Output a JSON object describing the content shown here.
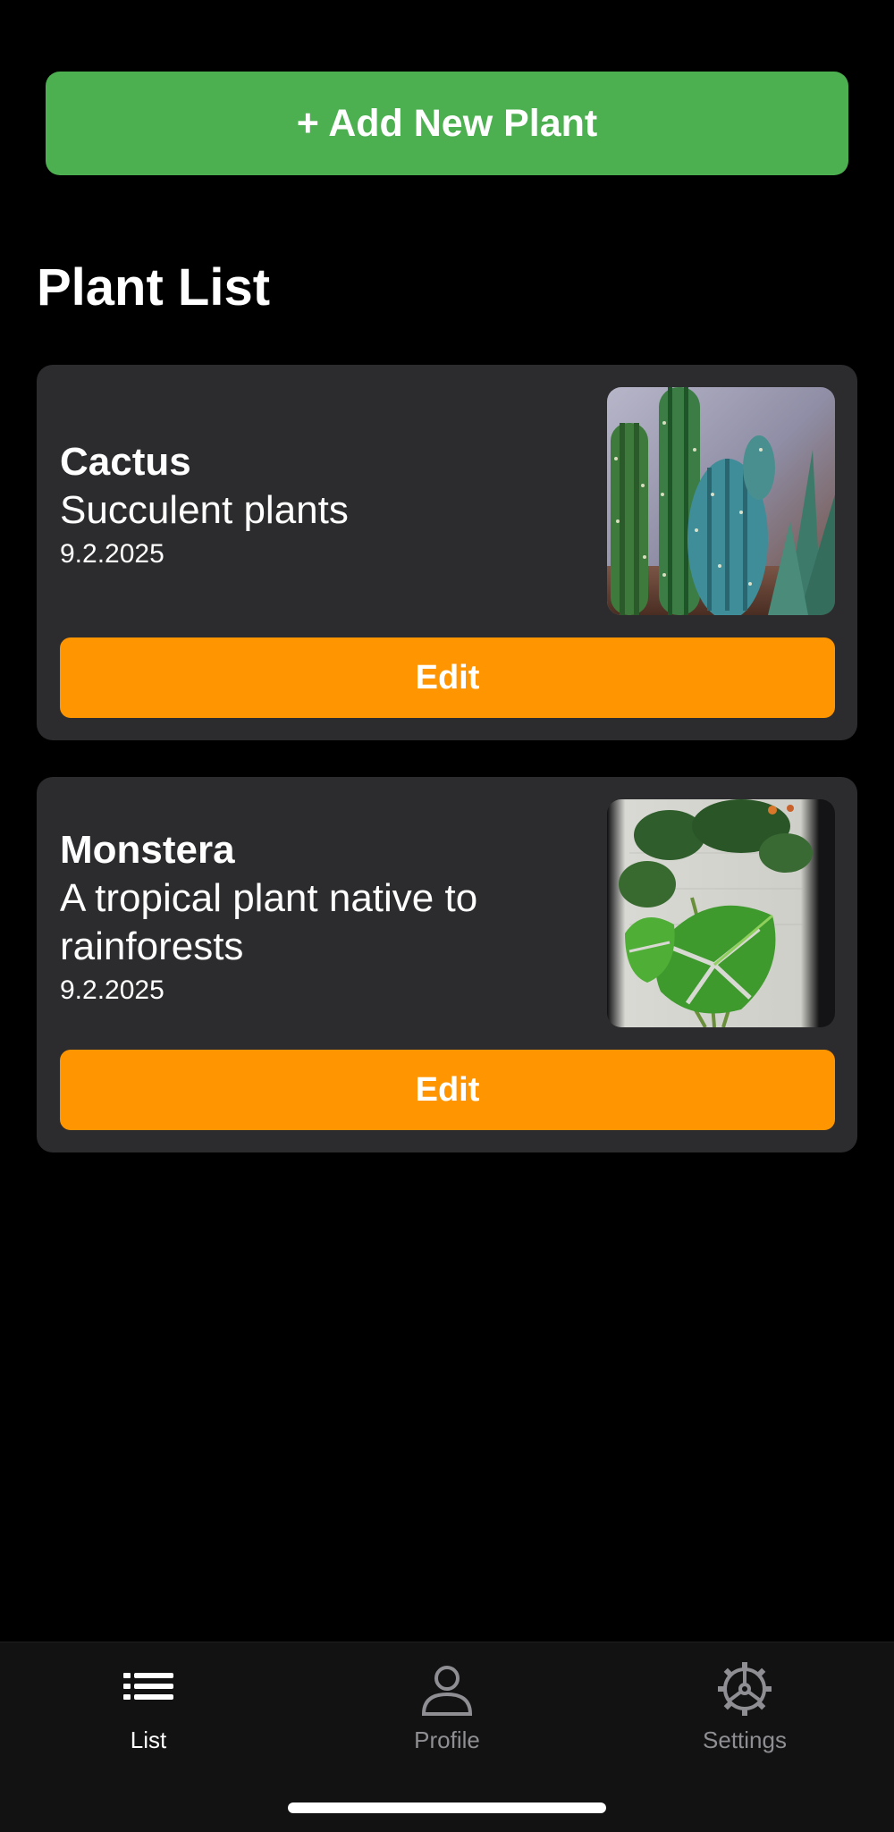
{
  "add_button": {
    "label": "+ Add New Plant",
    "color": "#4caf50"
  },
  "page_title": "Plant List",
  "plants": [
    {
      "name": "Cactus",
      "description": "Succulent plants",
      "date": "9.2.2025",
      "image": "cactus-photo",
      "edit_label": "Edit"
    },
    {
      "name": "Monstera",
      "description": "A tropical plant native to rainforests",
      "date": "9.2.2025",
      "image": "monstera-photo",
      "edit_label": "Edit"
    }
  ],
  "edit_color": "#ff9500",
  "tab_bar": {
    "tabs": [
      {
        "label": "List",
        "icon": "list-icon",
        "active": true
      },
      {
        "label": "Profile",
        "icon": "person-icon",
        "active": false
      },
      {
        "label": "Settings",
        "icon": "gear-icon",
        "active": false
      }
    ]
  }
}
